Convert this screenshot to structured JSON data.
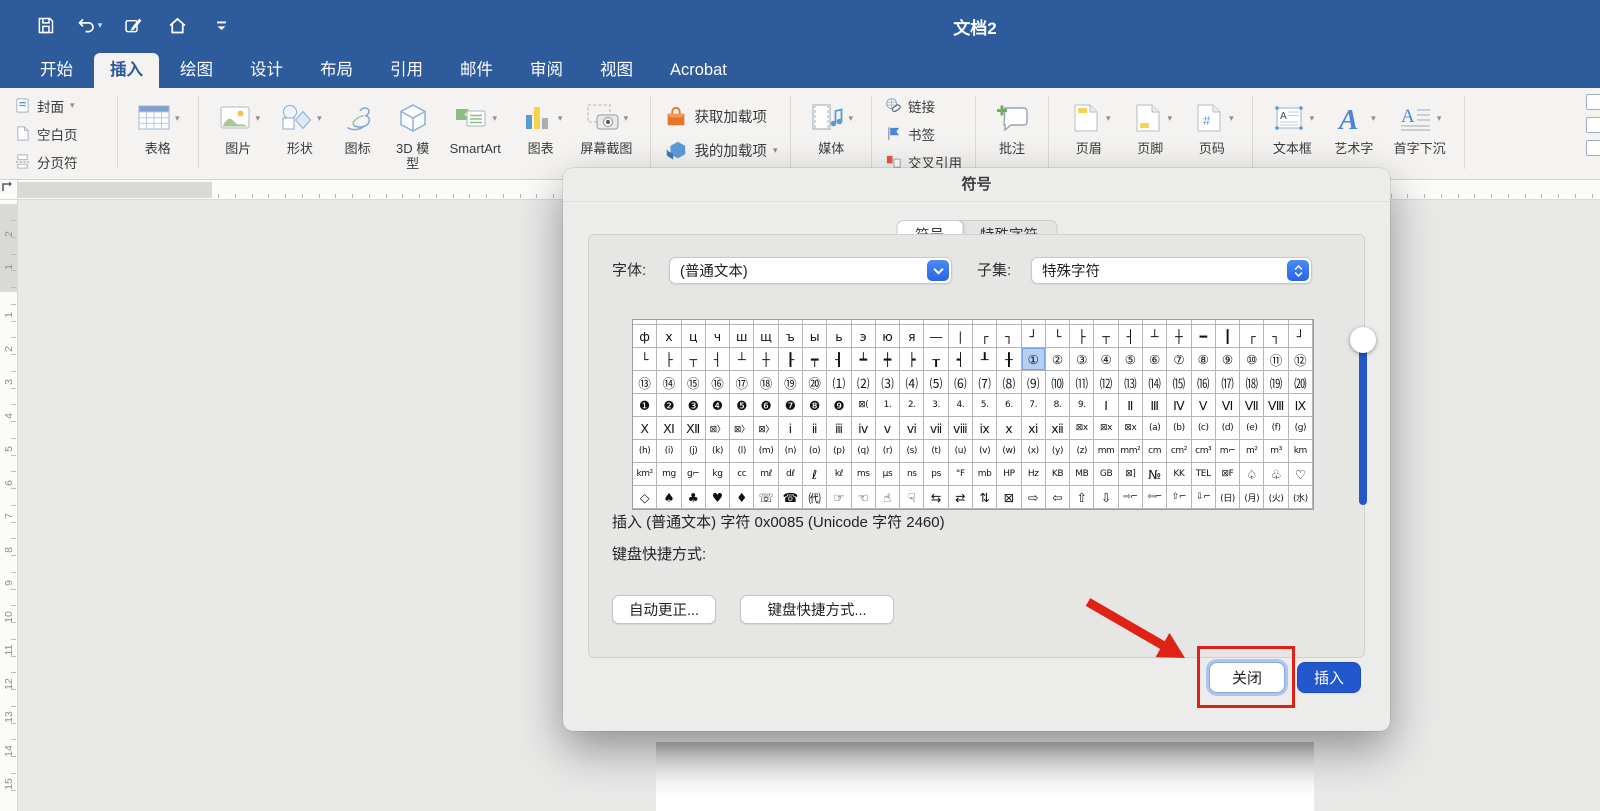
{
  "app": {
    "title": "文档2"
  },
  "colors": {
    "titlebar_blue": "#2d5b9b",
    "accent_blue": "#2b579a",
    "insert_button_blue": "#2257cd",
    "scrollbar_track_blue": "#2456c5",
    "selected_cell_blue": "#b5d0f3",
    "annotation_red": "#e02116"
  },
  "quick_access": [
    {
      "name": "save"
    },
    {
      "name": "undo",
      "dropdown": true
    },
    {
      "name": "redo"
    },
    {
      "name": "home"
    },
    {
      "name": "customize-toolbar"
    }
  ],
  "ribbon_tabs": [
    {
      "name": "home",
      "label": "开始"
    },
    {
      "name": "insert",
      "label": "插入",
      "selected": true
    },
    {
      "name": "draw",
      "label": "绘图"
    },
    {
      "name": "design",
      "label": "设计"
    },
    {
      "name": "layout",
      "label": "布局"
    },
    {
      "name": "references",
      "label": "引用"
    },
    {
      "name": "mailings",
      "label": "邮件"
    },
    {
      "name": "review",
      "label": "审阅"
    },
    {
      "name": "view",
      "label": "视图"
    },
    {
      "name": "acrobat",
      "label": "Acrobat"
    }
  ],
  "ribbon": {
    "pages_group": [
      {
        "name": "cover-page",
        "label": "封面",
        "dropdown": true
      },
      {
        "name": "blank-page",
        "label": "空白页"
      },
      {
        "name": "page-break",
        "label": "分页符"
      }
    ],
    "groups": [
      {
        "type": "big",
        "items": [
          {
            "name": "table",
            "label": "表格",
            "dropdown": true
          }
        ]
      },
      {
        "type": "big",
        "items": [
          {
            "name": "picture",
            "label": "图片",
            "dropdown": true
          },
          {
            "name": "shapes",
            "label": "形状",
            "dropdown": true
          },
          {
            "name": "icons",
            "label": "图标"
          },
          {
            "name": "model-3d",
            "label": "3D 模型"
          },
          {
            "name": "smartart",
            "label": "SmartArt",
            "dropdown": true
          },
          {
            "name": "chart",
            "label": "图表",
            "dropdown": true
          },
          {
            "name": "screenshot",
            "label": "屏幕截图",
            "dropdown": true
          }
        ]
      },
      {
        "type": "stack-lg",
        "items": [
          {
            "name": "get-add-ins",
            "label": "获取加载项"
          },
          {
            "name": "my-add-ins",
            "label": "我的加载项",
            "dropdown": true
          }
        ]
      },
      {
        "type": "big",
        "items": [
          {
            "name": "media",
            "label": "媒体",
            "dropdown": true
          }
        ]
      },
      {
        "type": "stack",
        "items": [
          {
            "name": "link",
            "label": "链接"
          },
          {
            "name": "bookmark",
            "label": "书签"
          },
          {
            "name": "cross-reference",
            "label": "交叉引用"
          }
        ]
      },
      {
        "type": "big",
        "items": [
          {
            "name": "comment",
            "label": "批注"
          }
        ]
      },
      {
        "type": "big",
        "items": [
          {
            "name": "header",
            "label": "页眉",
            "dropdown": true
          },
          {
            "name": "footer",
            "label": "页脚",
            "dropdown": true
          },
          {
            "name": "page-number",
            "label": "页码",
            "dropdown": true
          }
        ]
      },
      {
        "type": "big",
        "items": [
          {
            "name": "text-box",
            "label": "文本框",
            "dropdown": true
          },
          {
            "name": "wordart",
            "label": "艺术字",
            "dropdown": true
          },
          {
            "name": "drop-cap",
            "label": "首字下沉",
            "dropdown": true
          }
        ]
      }
    ]
  },
  "ruler": {
    "margin_numbers": [
      "2",
      "1"
    ],
    "numbers": [
      "1",
      "2",
      "3",
      "4",
      "5",
      "6",
      "7",
      "8",
      "9",
      "10",
      "11",
      "12",
      "13",
      "14",
      "15"
    ]
  },
  "dialog": {
    "title": "符号",
    "tabs": [
      "符号",
      "特殊字符"
    ],
    "font_label": "字体:",
    "font_value": "(普通文本)",
    "subset_label": "子集:",
    "subset_value": "特殊字符",
    "info_text": "插入 (普通文本) 字符 0x0085 (Unicode 字符 2460)",
    "shortcut_label": "键盘快捷方式:",
    "autocorrect_label": "自动更正...",
    "shortcut_button_label": "键盘快捷方式...",
    "close_label": "关闭",
    "insert_label": "插入",
    "grid": {
      "selected": {
        "row": 1,
        "col": 16,
        "char": "①"
      },
      "rows": [
        [
          "ф",
          "х",
          "ц",
          "ч",
          "ш",
          "щ",
          "ъ",
          "ы",
          "ь",
          "э",
          "ю",
          "я",
          "―",
          "∣",
          "┌",
          "┐",
          "┘",
          "└",
          "├",
          "┬",
          "┤",
          "┴",
          "┼",
          "━",
          "┃",
          "┌",
          "┐",
          "┘"
        ],
        [
          "└",
          "├",
          "┬",
          "┤",
          "┴",
          "┼",
          "┠",
          "┯",
          "┨",
          "┷",
          "┿",
          "┝",
          "┰",
          "┥",
          "┸",
          "╂",
          "①",
          "②",
          "③",
          "④",
          "⑤",
          "⑥",
          "⑦",
          "⑧",
          "⑨",
          "⑩",
          "⑪",
          "⑫"
        ],
        [
          "⑬",
          "⑭",
          "⑮",
          "⑯",
          "⑰",
          "⑱",
          "⑲",
          "⑳",
          "⑴",
          "⑵",
          "⑶",
          "⑷",
          "⑸",
          "⑹",
          "⑺",
          "⑻",
          "⑼",
          "⑽",
          "⑾",
          "⑿",
          "⒀",
          "⒁",
          "⒂",
          "⒃",
          "⒄",
          "⒅",
          "⒆",
          "⒇"
        ],
        [
          "❶",
          "❷",
          "❸",
          "❹",
          "❺",
          "❻",
          "❼",
          "❽",
          "❾",
          "⊠(",
          "1.",
          "2.",
          "3.",
          "4.",
          "5.",
          "6.",
          "7.",
          "8.",
          "9.",
          "Ⅰ",
          "Ⅱ",
          "Ⅲ",
          "Ⅳ",
          "Ⅴ",
          "Ⅵ",
          "Ⅶ",
          "Ⅷ",
          "Ⅸ"
        ],
        [
          "Ⅹ",
          "Ⅺ",
          "Ⅻ",
          "⊠〉",
          "⊠〉",
          "⊠〉",
          "ⅰ",
          "ⅱ",
          "ⅲ",
          "ⅳ",
          "ⅴ",
          "ⅵ",
          "ⅶ",
          "ⅷ",
          "ⅸ",
          "ⅹ",
          "ⅺ",
          "ⅻ",
          "⊠x",
          "⊠x",
          "⊠x",
          "(a)",
          "(b)",
          "(c)",
          "(d)",
          "(e)",
          "(f)",
          "(g)"
        ],
        [
          "(h)",
          "(i)",
          "(j)",
          "(k)",
          "(l)",
          "(m)",
          "(n)",
          "(o)",
          "(p)",
          "(q)",
          "(r)",
          "(s)",
          "(t)",
          "(u)",
          "(v)",
          "(w)",
          "(x)",
          "(y)",
          "(z)",
          "mm",
          "mm²",
          "cm",
          "cm²",
          "cm³",
          "m⌐",
          "m²",
          "m³",
          "km"
        ],
        [
          "km²",
          "mg",
          "g⌐",
          "kg",
          "cc",
          "mℓ",
          "dℓ",
          "ℓ",
          "kℓ",
          "ms",
          "μs",
          "ns",
          "ps",
          "°F",
          "mb",
          "HP",
          "Hz",
          "KB",
          "MB",
          "GB",
          "⊠]",
          "№",
          "KK",
          "TEL",
          "⊠F",
          "♤",
          "♧",
          "♡"
        ],
        [
          "◇",
          "♠",
          "♣",
          "♥",
          "♦",
          "☏",
          "☎",
          "㈹",
          "☞",
          "☜",
          "☝",
          "☟",
          "⇆",
          "⇄",
          "⇅",
          "⊠",
          "⇨",
          "⇦",
          "⇧",
          "⇩",
          "⇨⌐",
          "⇦⌐",
          "⇧⌐",
          "⇩⌐",
          "(日)",
          "(月)",
          "(火)",
          "(水)"
        ]
      ]
    }
  }
}
